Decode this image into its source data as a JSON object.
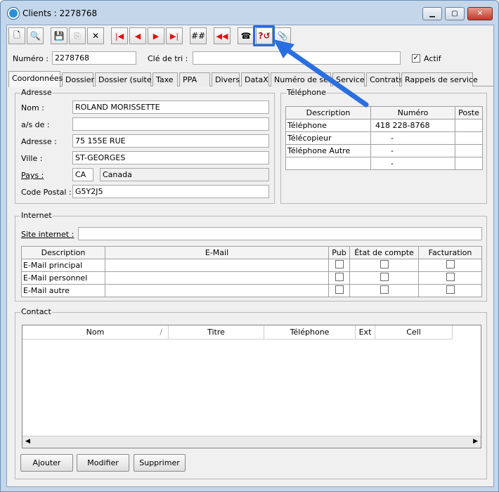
{
  "window": {
    "title": "Clients : 2278768",
    "min": "▁",
    "max": "▢",
    "close": "✕"
  },
  "toolbar": {
    "new": "🗋",
    "find": "🔍",
    "save": "💾",
    "copy": "⎘",
    "delete": "✕",
    "first": "|◀",
    "prev": "◀",
    "next": "▶",
    "last": "▶|",
    "renumber": "##",
    "back": "◀◀",
    "phone": "☎",
    "help": "?↺",
    "attach": "📎"
  },
  "header": {
    "numero_label": "Numéro :",
    "numero_value": "2278768",
    "cle_label": "Clé de tri :",
    "cle_value": "",
    "actif_label": "Actif",
    "actif_checked": "✓"
  },
  "tabs": [
    "Coordonnées",
    "Dossier",
    "Dossier (suite)",
    "Taxe",
    "PPA",
    "Divers",
    "DataX",
    "Numéro de série",
    "Service",
    "Contrats",
    "Rappels de service"
  ],
  "adresse": {
    "title": "Adresse",
    "nom_label": "Nom :",
    "nom": "ROLAND MORISSETTE",
    "as_label": "a/s de :",
    "as": "",
    "adresse_label": "Adresse :",
    "adresse": "75 155E RUE",
    "ville_label": "Ville :",
    "ville": "ST-GEORGES",
    "pays_label": "Pays :",
    "pays_code": "CA",
    "pays_name": "Canada",
    "cp_label": "Code Postal :",
    "cp": "G5Y2J5"
  },
  "telephone": {
    "title": "Téléphone",
    "headers": [
      "Description",
      "Numéro",
      "Poste"
    ],
    "rows": [
      [
        "Téléphone",
        "418 228-8768",
        ""
      ],
      [
        "Télécopieur",
        "-",
        ""
      ],
      [
        "Téléphone Autre",
        "-",
        ""
      ],
      [
        "",
        "-",
        ""
      ]
    ]
  },
  "internet": {
    "title": "Internet",
    "site_label": "Site internet :",
    "site": "",
    "headers": [
      "Description",
      "E-Mail",
      "Pub",
      "État de compte",
      "Facturation"
    ],
    "rows": [
      "E-Mail principal",
      "E-Mail personnel",
      "E-Mail autre"
    ]
  },
  "contact": {
    "title": "Contact",
    "headers": [
      "Nom",
      "Titre",
      "Téléphone",
      "Ext",
      "Cell"
    ],
    "sort": "/",
    "buttons": {
      "add": "Ajouter",
      "edit": "Modifier",
      "delete": "Supprimer"
    }
  }
}
